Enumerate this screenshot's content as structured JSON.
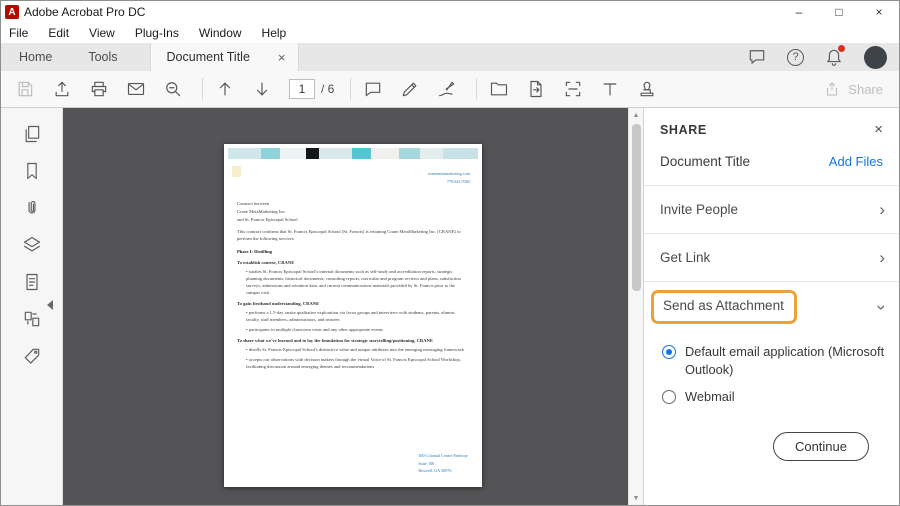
{
  "icons": {
    "logo_letter": "A",
    "minimize": "–",
    "maximize": "□",
    "close": "×",
    "tab_close": "×",
    "panel_close": "×",
    "help": "?",
    "chevron_right": "›",
    "chevron_down": "›",
    "scroll_up": "▲",
    "scroll_down": "▼"
  },
  "titlebar": {
    "app_title": "Adobe Acrobat Pro DC"
  },
  "menubar": {
    "items": [
      "File",
      "Edit",
      "View",
      "Plug-Ins",
      "Window",
      "Help"
    ]
  },
  "tabbar": {
    "home": "Home",
    "tools": "Tools",
    "active_tab": "Document Title"
  },
  "toolbar": {
    "page_current": "1",
    "page_total": "/ 6",
    "share_label": "Share"
  },
  "share_panel": {
    "title": "SHARE",
    "document_title": "Document Title",
    "add_files_link": "Add Files",
    "invite_people": "Invite People",
    "get_link": "Get Link",
    "send_as_attachment": "Send as Attachment",
    "option_default_email": "Default email application (Microsoft Outlook)",
    "option_webmail": "Webmail",
    "continue_label": "Continue",
    "accent_orange": "#E9A13B",
    "accent_blue": "#1473E6"
  },
  "document": {
    "contact_site": "cranemetamarketing.com",
    "contact_phone": "770.641.9382",
    "paras": [
      "Contract between",
      "Crane MetaMarketing Inc.",
      "and St. Francis Episcopal School",
      "This contract confirms that St. Francis Episcopal School (St. Francis) is retaining Crane MetaMarketing Inc. (CRANE) to perform the following services.",
      "Phase I: Distilling",
      "To establish context, CRANE",
      "studies St. Francis Episcopal School's internal documents such as self-study and accreditation reports, strategic planning documents, historical documents, consulting reports, curricular and program reviews and plans, satisfaction surveys, admissions and retention data, and current communications materials provided by St. Francis prior to the campus visit",
      "To gain firsthand understanding, CRANE",
      "performs a 1.5-day onsite qualitative exploration via focus groups and interviews with students, parents, alumni, faculty, staff members, administrators, and trustees",
      "participates in multiple classroom visits and any other appropriate events",
      "To share what we've learned and to lay the foundation for strategic storytelling/positioning, CRANE",
      "distills St. Francis Episcopal School's distinctive value and unique attributes into the emerging messaging framework",
      "accepts our observations with decision makers through the virtual Voice of St. Francis Episcopal School Workshop, facilitating discussion around emerging themes and recommendations"
    ],
    "footer_lines": [
      "300 Colonial Center Parkway",
      "Suite 100",
      "Roswell, GA 30076"
    ]
  }
}
